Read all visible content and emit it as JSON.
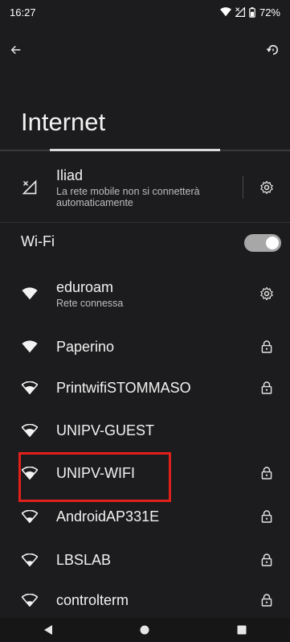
{
  "status": {
    "time": "16:27",
    "battery": "72%"
  },
  "page": {
    "title": "Internet"
  },
  "mobile": {
    "name": "Iliad",
    "subtitle_line1": "La rete mobile non si connetterà",
    "subtitle_line2": "automaticamente"
  },
  "wifi": {
    "header": "Wi-Fi",
    "enabled": true,
    "networks": [
      {
        "name": "eduroam",
        "subtitle": "Rete connessa",
        "locked": false,
        "settings": true
      },
      {
        "name": "Paperino",
        "locked": true
      },
      {
        "name": "PrintwifiSTOMMASO",
        "locked": true
      },
      {
        "name": "UNIPV-GUEST",
        "locked": false
      },
      {
        "name": "UNIPV-WIFI",
        "locked": true,
        "highlighted": true
      },
      {
        "name": "AndroidAP331E",
        "locked": true
      },
      {
        "name": "LBSLAB",
        "locked": true
      },
      {
        "name": "controlterm",
        "locked": true
      }
    ]
  },
  "colors": {
    "highlight": "#e0201b",
    "background": "#1c1c1e"
  }
}
